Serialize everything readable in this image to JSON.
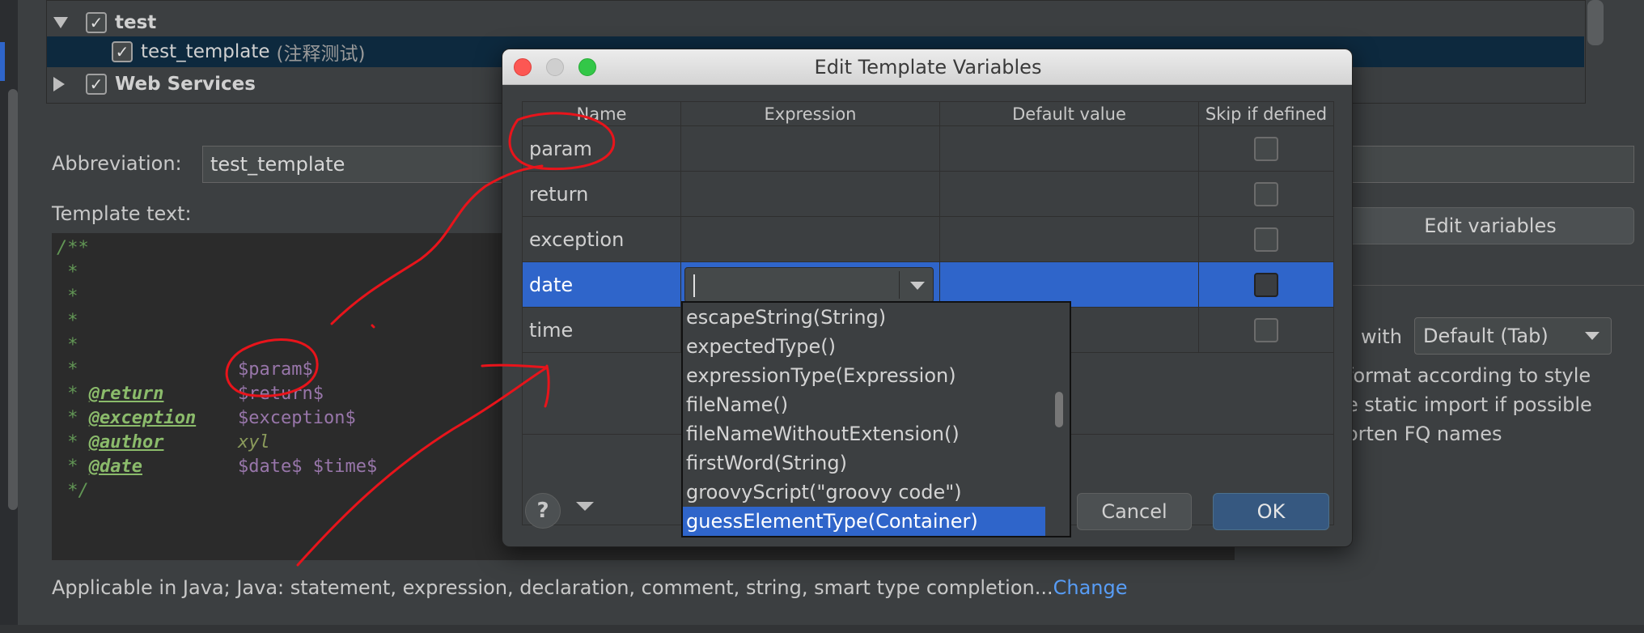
{
  "tree": {
    "items": [
      {
        "label": "test",
        "expanded": true,
        "checked": true
      },
      {
        "label": "test_template",
        "suffix": "(注释测试)",
        "checked": true,
        "selected": true
      },
      {
        "label": "Web Services",
        "expanded": false,
        "checked": true
      }
    ]
  },
  "form": {
    "abbreviation_label": "Abbreviation:",
    "abbreviation_value": "test_template",
    "template_text_label": "Template text:",
    "edit_variables_label": "Edit variables",
    "expand_with_label": "with",
    "expand_with_value": "Default (Tab)",
    "options": [
      "format according to style",
      "e static import if possible",
      "orten FQ names"
    ],
    "applicable_text": "Applicable in Java; Java: statement, expression, declaration, comment, string, smart type completion...",
    "change_link": "Change"
  },
  "template_code": {
    "open": "/**",
    "star": " *",
    "param_var": "$param$",
    "return_tag": "@return",
    "return_var": "$return$",
    "exception_tag": "@exception",
    "exception_var": "$exception$",
    "author_tag": "@author",
    "author_value": "xyl",
    "date_tag": "@date",
    "date_var": "$date$ $time$",
    "close": " */"
  },
  "dialog": {
    "title": "Edit Template Variables",
    "columns": [
      "Name",
      "Expression",
      "Default value",
      "Skip if defined"
    ],
    "rows": [
      {
        "name": "param",
        "expression": "",
        "default": "",
        "skip": false
      },
      {
        "name": "return",
        "expression": "",
        "default": "",
        "skip": false
      },
      {
        "name": "exception",
        "expression": "",
        "default": "",
        "skip": false
      },
      {
        "name": "date",
        "expression": "",
        "default": "",
        "skip": false,
        "selected": true
      },
      {
        "name": "time",
        "expression": "",
        "default": "",
        "skip": false
      }
    ],
    "help_label": "?",
    "cancel_label": "Cancel",
    "ok_label": "OK",
    "colors": {
      "selection": "#2f65ca",
      "primary_button": "#365880",
      "link": "#589df6",
      "annotation": "#e8141b"
    }
  },
  "dropdown": {
    "items": [
      "escapeString(String)",
      "expectedType()",
      "expressionType(Expression)",
      "fileName()",
      "fileNameWithoutExtension()",
      "firstWord(String)",
      "groovyScript(\"groovy code\")",
      "guessElementType(Container)"
    ],
    "selected_index": 7
  }
}
